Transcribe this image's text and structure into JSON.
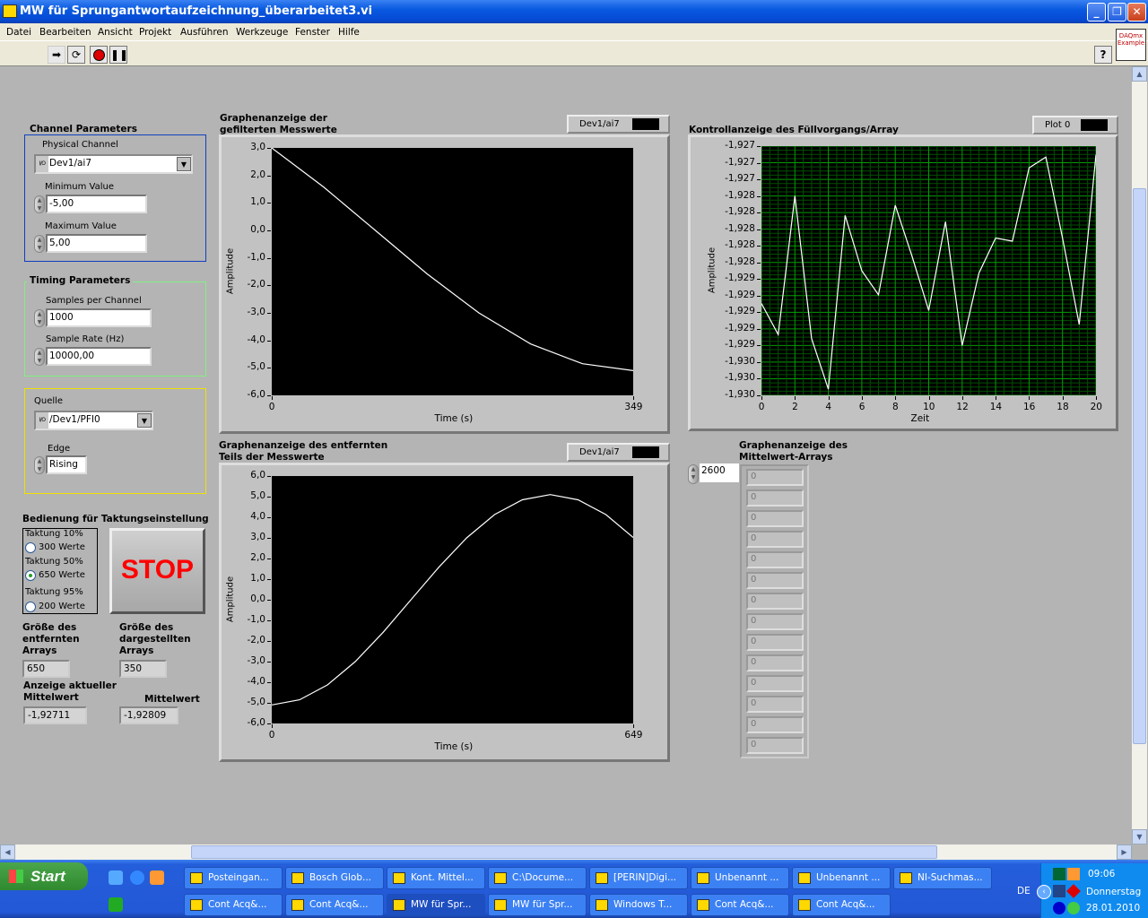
{
  "window": {
    "title": "MW für Sprungantwortaufzeichnung_überarbeitet3.vi"
  },
  "menu": [
    "Datei",
    "Bearbeiten",
    "Ansicht",
    "Projekt",
    "Ausführen",
    "Werkzeuge",
    "Fenster",
    "Hilfe"
  ],
  "toolbar": {
    "help": "?",
    "example_icon": "DAQmx Example"
  },
  "channel": {
    "title": "Channel Parameters",
    "physical_label": "Physical Channel",
    "physical_value": "Dev1/ai7",
    "io": "I/O",
    "min_label": "Minimum Value",
    "min_value": "-5,00",
    "max_label": "Maximum Value",
    "max_value": "5,00"
  },
  "timing": {
    "title": "Timing Parameters",
    "samples_label": "Samples per Channel",
    "samples_value": "1000",
    "rate_label": "Sample Rate (Hz)",
    "rate_value": "10000,00"
  },
  "trigger": {
    "source_label": "Quelle",
    "source_value": "/Dev1/PFI0",
    "edge_label": "Edge",
    "edge_value": "Rising"
  },
  "clocking": {
    "title": "Bedienung für Taktungseinstellung",
    "options": [
      {
        "caption": "Taktung 10%",
        "label": "300 Werte",
        "selected": false
      },
      {
        "caption": "Taktung 50%",
        "label": "650 Werte",
        "selected": true
      },
      {
        "caption": "Taktung 95%",
        "label": "200 Werte",
        "selected": false
      }
    ]
  },
  "stop_button": "STOP",
  "indicators": {
    "removed_label": "Größe des entfernten Arrays",
    "removed_value": "650",
    "shown_label": "Größe des dargestellten Arrays",
    "shown_value": "350",
    "current_mean_label": "Anzeige aktueller Mittelwert",
    "current_mean_value": "-1,92711",
    "mean_label": "Mittelwert",
    "mean_value": "-1,92809"
  },
  "mean_array": {
    "title": "Graphenanzeige des Mittelwert-Arrays",
    "index": "2600",
    "values": [
      "0",
      "0",
      "0",
      "0",
      "0",
      "0",
      "0",
      "0",
      "0",
      "0",
      "0",
      "0",
      "0",
      "0"
    ]
  },
  "chart_data": [
    {
      "type": "line",
      "title": "Graphenanzeige der gefilterten Messwerte",
      "legend": "Dev1/ai7",
      "xlabel": "Time (s)",
      "ylabel": "Amplitude",
      "xlim": [
        0,
        349
      ],
      "ylim": [
        -6,
        3
      ],
      "grid": false,
      "yticks": [
        "3,0",
        "2,0",
        "1,0",
        "0,0",
        "-1,0",
        "-2,0",
        "-3,0",
        "-4,0",
        "-5,0",
        "-6,0"
      ],
      "xticks": [
        "0",
        "349"
      ],
      "x": [
        0,
        50,
        100,
        150,
        200,
        250,
        300,
        349
      ],
      "y": [
        3.0,
        1.58,
        0.0,
        -1.58,
        -3.0,
        -4.13,
        -4.85,
        -5.1
      ]
    },
    {
      "type": "line",
      "title": "Graphenanzeige des entfernten Teils der Messwerte",
      "legend": "Dev1/ai7",
      "xlabel": "Time (s)",
      "ylabel": "Amplitude",
      "xlim": [
        0,
        649
      ],
      "ylim": [
        -6,
        6
      ],
      "grid": false,
      "yticks": [
        "6,0",
        "5,0",
        "4,0",
        "3,0",
        "2,0",
        "1,0",
        "0,0",
        "-1,0",
        "-2,0",
        "-3,0",
        "-4,0",
        "-5,0",
        "-6,0"
      ],
      "xticks": [
        "0",
        "649"
      ],
      "x": [
        0,
        50,
        100,
        150,
        200,
        250,
        300,
        350,
        400,
        450,
        500,
        550,
        600,
        649
      ],
      "y": [
        -5.1,
        -4.85,
        -4.13,
        -3.0,
        -1.58,
        0.0,
        1.58,
        3.0,
        4.13,
        4.85,
        5.1,
        4.85,
        4.13,
        3.02
      ]
    },
    {
      "type": "line",
      "title": "Kontrollanzeige des Füllvorgangs/Array",
      "legend": "Plot 0",
      "xlabel": "Zeit",
      "ylabel": "Amplitude",
      "xlim": [
        0,
        20
      ],
      "ylim": [
        -1.9302,
        -1.927
      ],
      "grid": true,
      "yticks": [
        "-1,927",
        "-1,927",
        "-1,927",
        "-1,928",
        "-1,928",
        "-1,928",
        "-1,928",
        "-1,928",
        "-1,929",
        "-1,929",
        "-1,929",
        "-1,929",
        "-1,929",
        "-1,930",
        "-1,930",
        "-1,930"
      ],
      "xticks": [
        "0",
        "2",
        "4",
        "6",
        "8",
        "10",
        "12",
        "14",
        "16",
        "18",
        "20"
      ],
      "x": [
        0,
        1,
        2,
        3,
        4,
        5,
        6,
        7,
        8,
        9,
        10,
        11,
        12,
        13,
        14,
        15,
        16,
        17,
        18,
        19,
        20
      ],
      "y": [
        -1.92902,
        -1.92942,
        -1.92764,
        -1.92947,
        -1.93012,
        -1.92789,
        -1.9286,
        -1.92891,
        -1.92776,
        -1.92841,
        -1.92911,
        -1.92797,
        -1.92956,
        -1.92863,
        -1.92818,
        -1.92822,
        -1.92728,
        -1.92714,
        -1.92818,
        -1.92929,
        -1.92711
      ]
    }
  ],
  "taskbar": {
    "start": "Start",
    "row1": [
      "Posteingan...",
      "Bosch Glob...",
      "Kont. Mittel...",
      "C:\\Docume...",
      "[PERIN]Digi...",
      "Unbenannt ...",
      "Unbenannt ...",
      "NI-Suchmas..."
    ],
    "row2": [
      "Cont Acq&...",
      "Cont Acq&...",
      "MW für Spr...",
      "MW für Spr...",
      "Windows T...",
      "Cont Acq&...",
      "Cont Acq&..."
    ],
    "lang": "DE",
    "time": "09:06",
    "day": "Donnerstag",
    "date": "28.01.2010"
  },
  "colors": {
    "grid_major": "#00a000",
    "grid_minor": "#005000",
    "trace": "#ffffff",
    "stop": "#ff0000"
  }
}
